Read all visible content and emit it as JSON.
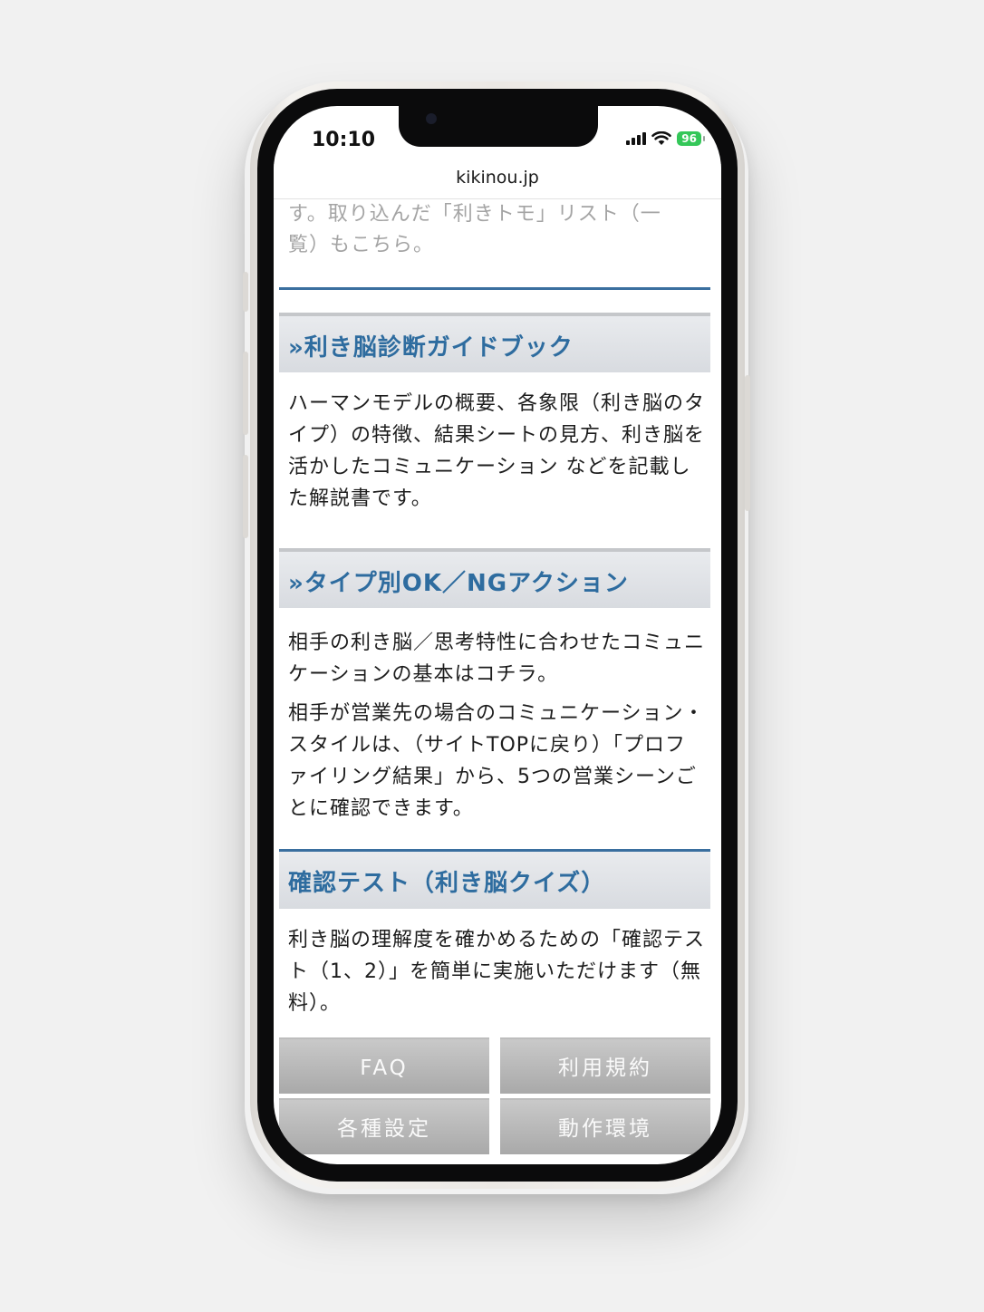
{
  "status_bar": {
    "time": "10:10",
    "battery": "96"
  },
  "browser": {
    "url": "kikinou.jp"
  },
  "intro_text": [
    "す。取り込んだ「利きトモ」リスト（一",
    "覧）もこちら。"
  ],
  "sections": [
    {
      "heading": "»利き脳診断ガイドブック",
      "paragraphs": [
        "ハーマンモデルの概要、各象限（利き脳のタイプ）の特徴、結果シートの見方、利き脳を活かしたコミュニケーション などを記載した解説書です。"
      ]
    },
    {
      "heading": "»タイプ別OK／NGアクション",
      "paragraphs": [
        "相手の利き脳／思考特性に合わせたコミュニケーションの基本はコチラ。",
        "相手が営業先の場合のコミュニケーション・スタイルは、（サイトTOPに戻り）「プロファイリング結果」から、5つの営業シーンごとに確認できます。"
      ]
    },
    {
      "heading": "確認テスト（利き脳クイズ）",
      "paragraphs": [
        "利き脳の理解度を確かめるための「確認テスト（1、2）」を簡単に実施いただけます（無料）。"
      ]
    }
  ],
  "footer_nav": {
    "faq": "FAQ",
    "terms": "利用規約",
    "settings": "各種設定",
    "environment": "動作環境"
  },
  "colors": {
    "accent": "#2e6c9f",
    "battery": "#34c759"
  }
}
